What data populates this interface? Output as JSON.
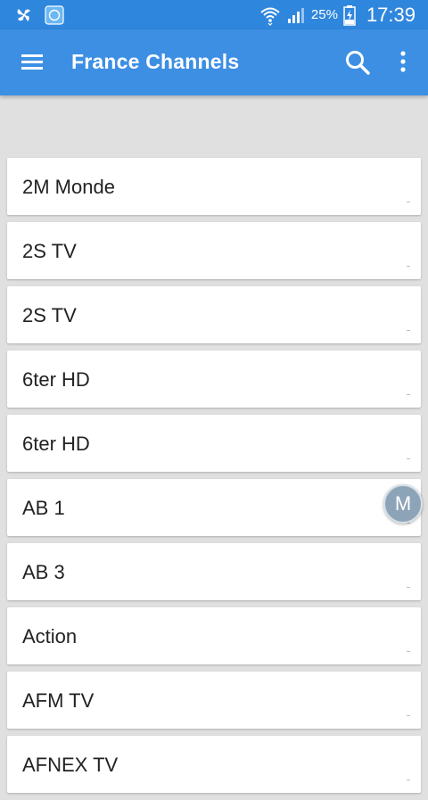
{
  "status_bar": {
    "battery_percent": "25%",
    "time": "17:39"
  },
  "app_bar": {
    "title": "France Channels",
    "icons": [
      "menu-icon",
      "search-icon",
      "more-vert-icon"
    ]
  },
  "channels": [
    {
      "label": "2M Monde"
    },
    {
      "label": "2S TV"
    },
    {
      "label": "2S TV"
    },
    {
      "label": "6ter HD"
    },
    {
      "label": "6ter HD"
    },
    {
      "label": "AB 1"
    },
    {
      "label": "AB 3"
    },
    {
      "label": "Action"
    },
    {
      "label": "AFM TV"
    },
    {
      "label": "AFNEX TV"
    }
  ],
  "floating_button": {
    "label": "M"
  },
  "colors": {
    "status_bar": "#2f86dd",
    "app_bar": "#3d8fe3",
    "background": "#e0e0e0",
    "card": "#ffffff",
    "floating_button": "#8da4b8"
  }
}
